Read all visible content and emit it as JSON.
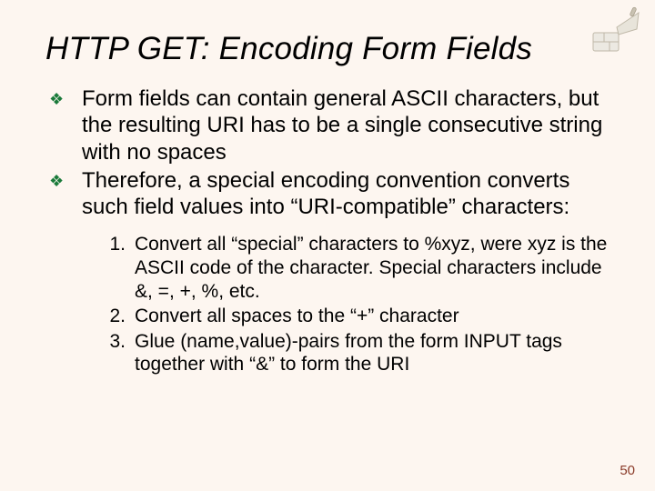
{
  "title": "HTTP GET: Encoding Form Fields",
  "bullets": [
    "Form fields can contain general ASCII characters, but the resulting URI has to be a single consecutive string with no spaces",
    "Therefore, a special encoding convention converts such field values into “URI-compatible” characters:"
  ],
  "numbered": [
    "Convert all “special” characters to %xyz, were xyz is the ASCII code of the character. Special characters include &, =, +, %, etc.",
    "Convert all spaces to the “+” character",
    "Glue (name,value)-pairs from the form INPUT tags together with “&” to form the URI"
  ],
  "page_number": "50",
  "glyphs": {
    "diamond": "❖"
  }
}
